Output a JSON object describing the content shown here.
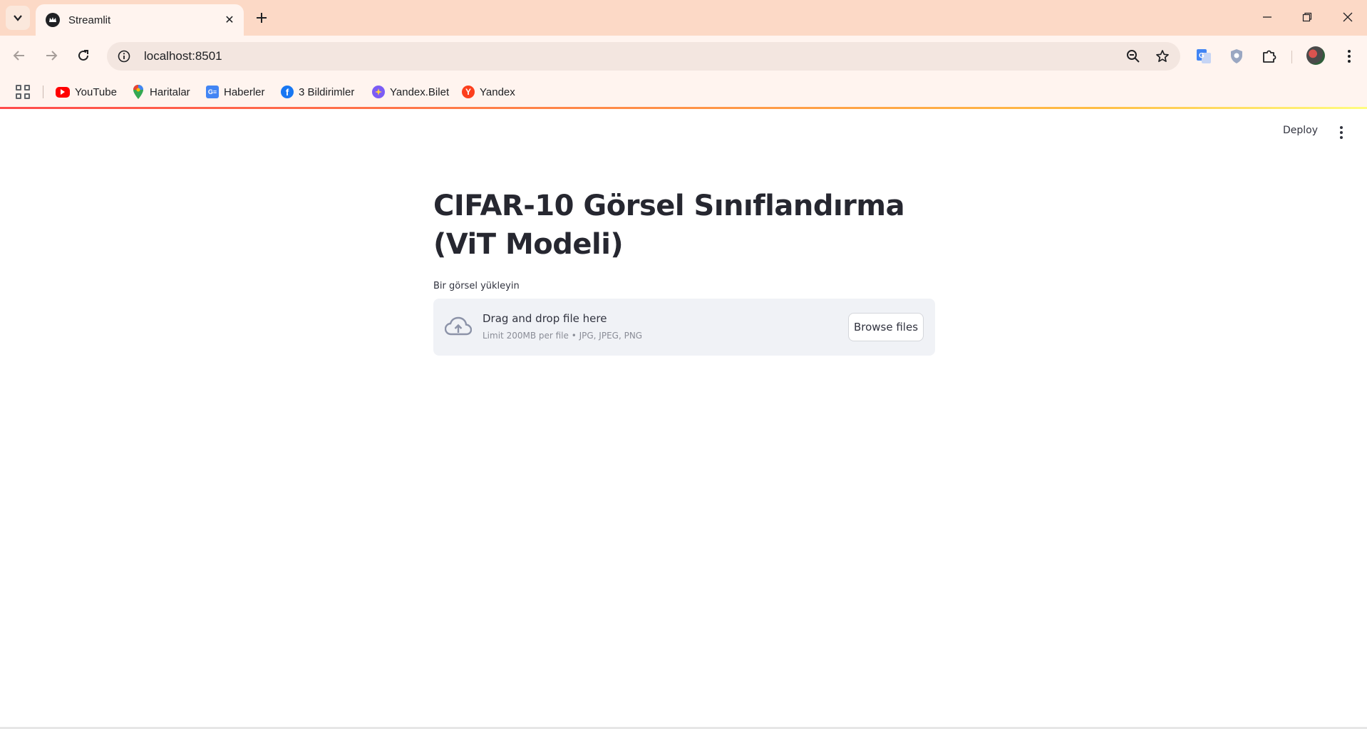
{
  "browser": {
    "tab": {
      "title": "Streamlit",
      "close": "✕"
    },
    "new_tab": "+",
    "address": {
      "url": "localhost:8501"
    },
    "bookmarks": [
      {
        "label": "YouTube",
        "icon": "youtube-icon",
        "color": "#ff0000"
      },
      {
        "label": "Haritalar",
        "icon": "maps-pin-icon",
        "color": "#34a853"
      },
      {
        "label": "Haberler",
        "icon": "news-icon",
        "color": "#4285f4"
      },
      {
        "label": "3 Bildirimler",
        "icon": "facebook-icon",
        "color": "#1877f2"
      },
      {
        "label": "Yandex.Bilet",
        "icon": "yandex-bilet-icon",
        "color": "#7b5cf5"
      },
      {
        "label": "Yandex",
        "icon": "yandex-icon",
        "color": "#fc3f1d"
      }
    ]
  },
  "app": {
    "deploy_label": "Deploy",
    "title": "CIFAR-10 Görsel Sınıflandırma (ViT Modeli)",
    "uploader": {
      "label": "Bir görsel yükleyin",
      "drop_text": "Drag and drop file here",
      "limit_text": "Limit 200MB per file • JPG, JPEG, PNG",
      "browse_label": "Browse files"
    }
  },
  "colors": {
    "titlebar": "#fcd9c6",
    "toolbar": "#fff4ef",
    "accent_gradient_start": "#ff4b4b",
    "dropzone": "#f0f2f6"
  }
}
